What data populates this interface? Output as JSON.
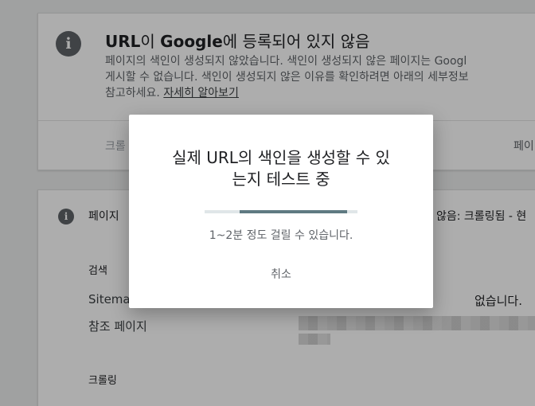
{
  "issue_card": {
    "title_prefix": "URL",
    "title_mid": "이 ",
    "title_brand": "Google",
    "title_suffix": "에 등록되어 있지 않음",
    "description_line1": "페이지의 색인이 생성되지 않았습니다. 색인이 생성되지 않은 페이지는 Googl",
    "description_line2": "게시할 수 없습니다. 색인이 생성되지 않은 이유를 확인하려면 아래의 세부정보",
    "description_line3_prefix": "참고하세요. ",
    "learn_more_link": "자세히 알아보기",
    "footer_left": "크롤",
    "footer_right": "페이"
  },
  "detail_card": {
    "section_title": "페이지",
    "status_text": "않음: 크롤링됨 - 현",
    "search_heading": "검색",
    "sitemap_label": "Sitema",
    "sitemap_value": "없습니다.",
    "referring_label": "참조 페이지",
    "crawl_heading": "크롤링"
  },
  "dialog": {
    "title_line1": "실제 URL의 색인을 생성할 수 있",
    "title_line2": "는지 테스트 중",
    "subtitle": "1~2분 정도 걸릴 수 있습니다.",
    "cancel_label": "취소",
    "progress": {
      "start_fraction": 0.23,
      "end_fraction": 0.93
    }
  },
  "colors": {
    "progress_fill": "#5f7a82",
    "progress_track": "#e0e6e8",
    "icon": "#5f6368"
  }
}
